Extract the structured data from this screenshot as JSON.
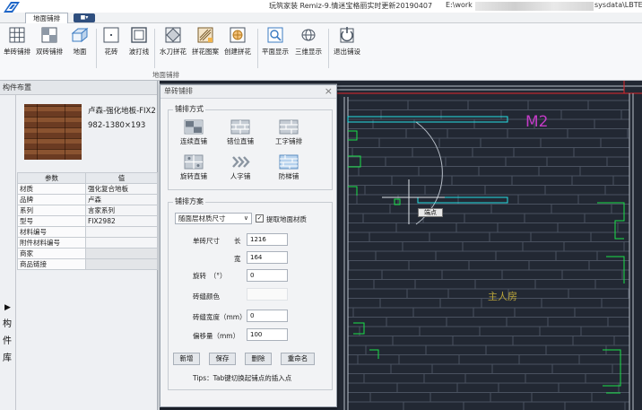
{
  "window": {
    "title": "玩筑家装 Remiz-9.情迷宝格丽实时更新20190407",
    "path_left": "E:\\work",
    "path_right": "sysdata\\LBTE"
  },
  "tabs": {
    "active": "地面铺排",
    "toggle": "■▾"
  },
  "ribbon": {
    "buttons": [
      {
        "label": "单砖铺排",
        "icon": "grid-tile-icon"
      },
      {
        "label": "双砖铺排",
        "icon": "double-tile-icon"
      },
      {
        "label": "地面",
        "icon": "floor-box-icon"
      },
      {
        "label": "花砖",
        "icon": "single-tile-icon"
      },
      {
        "label": "波打线",
        "icon": "border-line-icon"
      },
      {
        "label": "水刀拼花",
        "icon": "waterjet-icon"
      },
      {
        "label": "拼花图案",
        "icon": "pattern-icon"
      },
      {
        "label": "创建拼花",
        "icon": "create-pattern-icon"
      },
      {
        "label": "平面显示",
        "icon": "plan-view-icon"
      },
      {
        "label": "三维显示",
        "icon": "3d-view-icon"
      },
      {
        "label": "退出铺设",
        "icon": "exit-icon"
      }
    ],
    "group_label": "地面铺排"
  },
  "panel": {
    "title": "构件布置",
    "side_tab": [
      "构",
      "件",
      "库"
    ],
    "product_name": "卢森-强化地板-FIX2982-1380×193",
    "table": {
      "headers": [
        "参数",
        "值"
      ],
      "rows": [
        [
          "材质",
          "强化复合地板"
        ],
        [
          "品牌",
          "卢森"
        ],
        [
          "系列",
          "言家系列"
        ],
        [
          "型号",
          "FIX2982"
        ],
        [
          "材料编号",
          ""
        ],
        [
          "附件材料编号",
          ""
        ],
        [
          "商家",
          ""
        ],
        [
          "商品链接",
          ""
        ]
      ]
    }
  },
  "dialog": {
    "title": "单砖铺排",
    "method_legend": "铺排方式",
    "methods": [
      {
        "label": "连续直铺",
        "icon": "continuous-icon"
      },
      {
        "label": "错位直铺",
        "icon": "staggered-icon"
      },
      {
        "label": "工字铺排",
        "icon": "i-pattern-icon"
      },
      {
        "label": "旋转直铺",
        "icon": "rotate-icon"
      },
      {
        "label": "人字铺",
        "icon": "herringbone-icon"
      },
      {
        "label": "防梯铺",
        "icon": "anti-ladder-icon"
      }
    ],
    "scheme_legend": "铺排方案",
    "scheme_select": "随面层材质尺寸",
    "extract_checkbox": {
      "label": "提取地面材质",
      "checked": true
    },
    "size_label": "单砖尺寸",
    "length_label": "长",
    "length_value": "1216",
    "width_label": "宽",
    "width_value": "164",
    "rotate_label": "旋转　（°）",
    "rotate_value": "0",
    "joint_color_label": "砖缝颜色",
    "joint_width_label": "砖缝宽度（mm）",
    "joint_width_value": "0",
    "offset_label": "偏移量（mm）",
    "offset_value": "100",
    "buttons": [
      "新增",
      "保存",
      "删除",
      "重命名"
    ],
    "tips": "Tips：Tab键切换起铺点的插入点"
  },
  "cad": {
    "room_name": "主人房",
    "door_label": "M2",
    "tooltip": "端点",
    "colors": {
      "background": "#222833",
      "lines": "#b8bfc9",
      "green": "#19e24a",
      "cyan": "#27e0e6",
      "red": "#e0262b",
      "magenta": "#c33bc6",
      "yellow": "#b9a43a"
    }
  }
}
